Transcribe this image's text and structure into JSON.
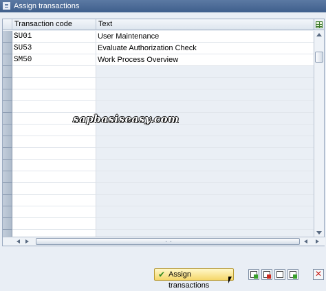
{
  "window": {
    "title": "Assign transactions"
  },
  "table": {
    "columns": [
      "Transaction code",
      "Text"
    ],
    "rows": [
      {
        "code": "SU01",
        "text": "User Maintenance"
      },
      {
        "code": "SU53",
        "text": "Evaluate Authorization Check"
      },
      {
        "code": "SM50",
        "text": "Work Process Overview"
      }
    ]
  },
  "watermark": "sapbasiseasy.com",
  "footer": {
    "assign_label": "Assign transactions"
  },
  "icons": {
    "title": "window-icon",
    "layout": "table-layout-icon",
    "assign": "check-icon",
    "close": "close-icon"
  },
  "colors": {
    "titlebar": "#3f5f8c",
    "assign_button": "#f5d76a",
    "close": "#c8201a"
  }
}
